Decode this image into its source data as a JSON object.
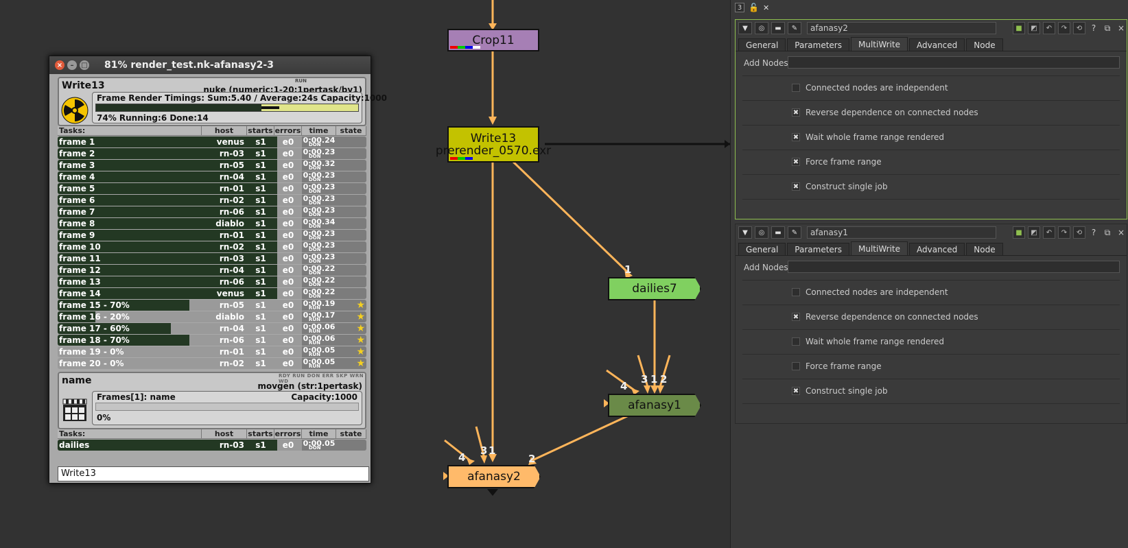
{
  "graph": {
    "nodes": {
      "crop": {
        "label": "Crop11",
        "color": "#a67fb5"
      },
      "write": {
        "label": "Write13",
        "sublabel": "prerender_0570.exr",
        "color": "#c3c200"
      },
      "dailies": {
        "label": "dailies7",
        "color": "#80d060"
      },
      "afanasy1": {
        "label": "afanasy1",
        "color": "#6a8a48"
      },
      "afanasy2": {
        "label": "afanasy2",
        "color": "#ffba6a"
      }
    },
    "edge_numbers": {
      "n1": "1",
      "a1_4": "4",
      "a1_3": "3",
      "a1_1": "1",
      "a1_2": "2",
      "a2_4": "4",
      "a2_3": "3",
      "a2_1": "1",
      "a2_2": "2"
    },
    "edge_color": "#ffb55a"
  },
  "monitor": {
    "title": "81% render_test.nk-afanasy2-3",
    "job1": {
      "name": "Write13",
      "run_label": "RUN",
      "service": "nuke (numeric:1-20:1pertask/by1)",
      "timings": "Frame Render Timings: Sum:5.40 / Average:24s Capacity:1000",
      "progress_done": 0.63,
      "progress_running": 0.07,
      "status": "74% Running:6 Done:14",
      "icon": "radiation-icon"
    },
    "task_headers": {
      "tasks": "Tasks:",
      "host": "host",
      "starts": "starts",
      "errors": "errors",
      "time": "time",
      "state": "state"
    },
    "tasks": [
      {
        "name": "frame 1",
        "host": "venus",
        "starts": "s1",
        "errors": "e0",
        "time": "0:00.24",
        "state": "DON",
        "progress": 1
      },
      {
        "name": "frame 2",
        "host": "rn-03",
        "starts": "s1",
        "errors": "e0",
        "time": "0:00.23",
        "state": "DON",
        "progress": 1
      },
      {
        "name": "frame 3",
        "host": "rn-05",
        "starts": "s1",
        "errors": "e0",
        "time": "0:00.32",
        "state": "DON",
        "progress": 1
      },
      {
        "name": "frame 4",
        "host": "rn-04",
        "starts": "s1",
        "errors": "e0",
        "time": "0:00.23",
        "state": "DON",
        "progress": 1
      },
      {
        "name": "frame 5",
        "host": "rn-01",
        "starts": "s1",
        "errors": "e0",
        "time": "0:00.23",
        "state": "DON",
        "progress": 1
      },
      {
        "name": "frame 6",
        "host": "rn-02",
        "starts": "s1",
        "errors": "e0",
        "time": "0:00.23",
        "state": "DON",
        "progress": 1
      },
      {
        "name": "frame 7",
        "host": "rn-06",
        "starts": "s1",
        "errors": "e0",
        "time": "0:00.23",
        "state": "DON",
        "progress": 1
      },
      {
        "name": "frame 8",
        "host": "diablo",
        "starts": "s1",
        "errors": "e0",
        "time": "0:00.34",
        "state": "DON",
        "progress": 1
      },
      {
        "name": "frame 9",
        "host": "rn-01",
        "starts": "s1",
        "errors": "e0",
        "time": "0:00.23",
        "state": "DON",
        "progress": 1
      },
      {
        "name": "frame 10",
        "host": "rn-02",
        "starts": "s1",
        "errors": "e0",
        "time": "0:00.23",
        "state": "DON",
        "progress": 1
      },
      {
        "name": "frame 11",
        "host": "rn-03",
        "starts": "s1",
        "errors": "e0",
        "time": "0:00.23",
        "state": "DON",
        "progress": 1
      },
      {
        "name": "frame 12",
        "host": "rn-04",
        "starts": "s1",
        "errors": "e0",
        "time": "0:00.22",
        "state": "DON",
        "progress": 1
      },
      {
        "name": "frame 13",
        "host": "rn-06",
        "starts": "s1",
        "errors": "e0",
        "time": "0:00.22",
        "state": "DON",
        "progress": 1
      },
      {
        "name": "frame 14",
        "host": "venus",
        "starts": "s1",
        "errors": "e0",
        "time": "0:00.22",
        "state": "DON",
        "progress": 1
      },
      {
        "name": "frame 15 - 70%",
        "host": "rn-05",
        "starts": "s1",
        "errors": "e0",
        "time": "0:00.19",
        "state": "RUN",
        "progress": 0.7
      },
      {
        "name": "frame 16 - 20%",
        "host": "diablo",
        "starts": "s1",
        "errors": "e0",
        "time": "0:00.17",
        "state": "RUN",
        "progress": 0.2
      },
      {
        "name": "frame 17 - 60%",
        "host": "rn-04",
        "starts": "s1",
        "errors": "e0",
        "time": "0:00.06",
        "state": "RUN",
        "progress": 0.6
      },
      {
        "name": "frame 18 - 70%",
        "host": "rn-06",
        "starts": "s1",
        "errors": "e0",
        "time": "0:00.06",
        "state": "RUN",
        "progress": 0.7
      },
      {
        "name": "frame 19 - 0%",
        "host": "rn-01",
        "starts": "s1",
        "errors": "e0",
        "time": "0:00.05",
        "state": "RUN",
        "progress": 0
      },
      {
        "name": "frame 20 - 0%",
        "host": "rn-02",
        "starts": "s1",
        "errors": "e0",
        "time": "0:00.05",
        "state": "RUN",
        "progress": 0
      }
    ],
    "job2": {
      "name": "name",
      "rdy_line": "RDY RUN DON ERR SKP WRN WD",
      "service": "movgen (str:1pertask)",
      "timings": "Frames[1]: name",
      "capacity": "Capacity:1000",
      "percent": "0%",
      "icon": "clapperboard-icon"
    },
    "tasks2": [
      {
        "name": "dailies",
        "host": "rn-03",
        "starts": "s1",
        "errors": "e0",
        "time": "0:00.05",
        "state": "DON",
        "progress": 1
      }
    ],
    "input_value": "Write13"
  },
  "properties": {
    "toolbar_count": "3",
    "tabs": [
      "General",
      "Parameters",
      "MultiWrite",
      "Advanced",
      "Node"
    ],
    "active_tab": "MultiWrite",
    "add_nodes_label": "Add Nodes",
    "panel1": {
      "name": "afanasy2",
      "checks": [
        {
          "label": "Connected nodes are independent",
          "checked": false
        },
        {
          "label": "Reverse dependence on connected nodes",
          "checked": true
        },
        {
          "label": "Wait whole frame range rendered",
          "checked": true
        },
        {
          "label": "Force frame range",
          "checked": true
        },
        {
          "label": "Construct single job",
          "checked": true
        }
      ]
    },
    "panel2": {
      "name": "afanasy1",
      "checks": [
        {
          "label": "Connected nodes are independent",
          "checked": false
        },
        {
          "label": "Reverse dependence on connected nodes",
          "checked": true
        },
        {
          "label": "Wait whole frame range rendered",
          "checked": false
        },
        {
          "label": "Force frame range",
          "checked": false
        },
        {
          "label": "Construct single job",
          "checked": true
        }
      ]
    }
  }
}
